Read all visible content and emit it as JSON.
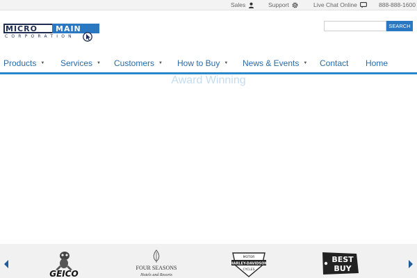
{
  "topbar": {
    "sales_label": "Sales",
    "support_label": "Support",
    "chat_label": "Live Chat Online",
    "phone": "888-888-1600"
  },
  "logo": {
    "word1": "MICRO",
    "word2": "MAIN",
    "subtitle": "CORPORATION"
  },
  "search": {
    "placeholder": "",
    "button_label": "SEARCH"
  },
  "nav": {
    "items": [
      {
        "label": "Products",
        "has_dropdown": true
      },
      {
        "label": "Services",
        "has_dropdown": true
      },
      {
        "label": "Customers",
        "has_dropdown": true
      },
      {
        "label": "How to Buy",
        "has_dropdown": true
      },
      {
        "label": "News & Events",
        "has_dropdown": true
      },
      {
        "label": "Contact",
        "has_dropdown": false
      },
      {
        "label": "Home",
        "has_dropdown": false
      }
    ],
    "caret": "▼"
  },
  "hero": {
    "text": "Award Winning"
  },
  "clients": {
    "geico": "GEICO",
    "four_seasons": "FOUR SEASONS",
    "four_seasons_sub": "Hotels and Resorts",
    "harley_top": "MOTOR",
    "harley": "HARLEY-DAVIDSON",
    "harley_bottom": "CYCLES",
    "bestbuy_1": "BEST",
    "bestbuy_2": "BUY"
  },
  "colors": {
    "brand_blue": "#2a78c2",
    "nav_text": "#2a6aa6",
    "logo_navy": "#1f2d52",
    "hero_text": "#c5dcef",
    "arrow": "#1f5c9a"
  },
  "icons": {
    "sales": "person-icon",
    "support": "gear-icon",
    "chat": "chat-bubble-icon",
    "prev": "chevron-left-icon",
    "next": "chevron-right-icon"
  }
}
